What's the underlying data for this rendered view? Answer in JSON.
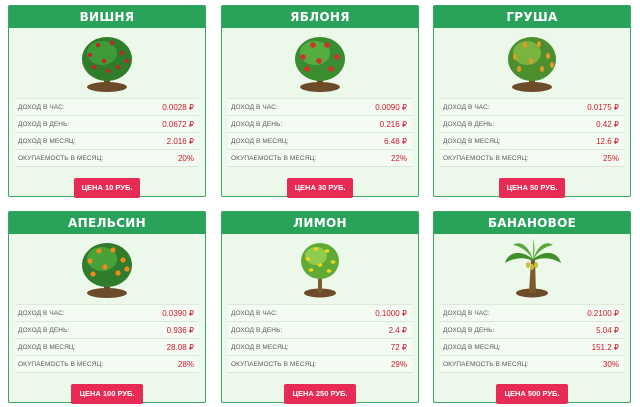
{
  "labels": {
    "per_hour": "ДОХОД В ЧАС:",
    "per_day": "ДОХОД В ДЕНЬ:",
    "per_month": "ДОХОД В МЕСЯЦ:",
    "payback": "ОКУПАЕМОСТЬ В МЕСЯЦ:"
  },
  "cards": [
    {
      "title": "ВИШНЯ",
      "tree_icon": "cherry-tree-icon",
      "fruit_color": "#c8232b",
      "per_hour": "0.0028 ₽",
      "per_day": "0.0672 ₽",
      "per_month": "2.016 ₽",
      "payback": "20%",
      "price": "ЦЕНА 10 РУБ."
    },
    {
      "title": "ЯБЛОНЯ",
      "tree_icon": "apple-tree-icon",
      "fruit_color": "#d1322e",
      "per_hour": "0.0090 ₽",
      "per_day": "0.216 ₽",
      "per_month": "6.48 ₽",
      "payback": "22%",
      "price": "ЦЕНА 30 РУБ."
    },
    {
      "title": "ГРУША",
      "tree_icon": "pear-tree-icon",
      "fruit_color": "#e39a2a",
      "per_hour": "0.0175 ₽",
      "per_day": "0.42 ₽",
      "per_month": "12.6 ₽",
      "payback": "25%",
      "price": "ЦЕНА 50 РУБ."
    },
    {
      "title": "АПЕЛЬСИН",
      "tree_icon": "orange-tree-icon",
      "fruit_color": "#ef8a1d",
      "per_hour": "0.0390 ₽",
      "per_day": "0.936 ₽",
      "per_month": "28.08 ₽",
      "payback": "28%",
      "price": "ЦЕНА 100 РУБ."
    },
    {
      "title": "ЛИМОН",
      "tree_icon": "lemon-tree-icon",
      "fruit_color": "#f1d21f",
      "per_hour": "0.1000 ₽",
      "per_day": "2.4 ₽",
      "per_month": "72 ₽",
      "payback": "29%",
      "price": "ЦЕНА 250 РУБ."
    },
    {
      "title": "БАНАНОВОЕ",
      "tree_icon": "banana-tree-icon",
      "fruit_color": "#c9c23a",
      "per_hour": "0.2100 ₽",
      "per_day": "5.04 ₽",
      "per_month": "151.2 ₽",
      "payback": "30%",
      "price": "ЦЕНА 500 РУБ."
    }
  ]
}
